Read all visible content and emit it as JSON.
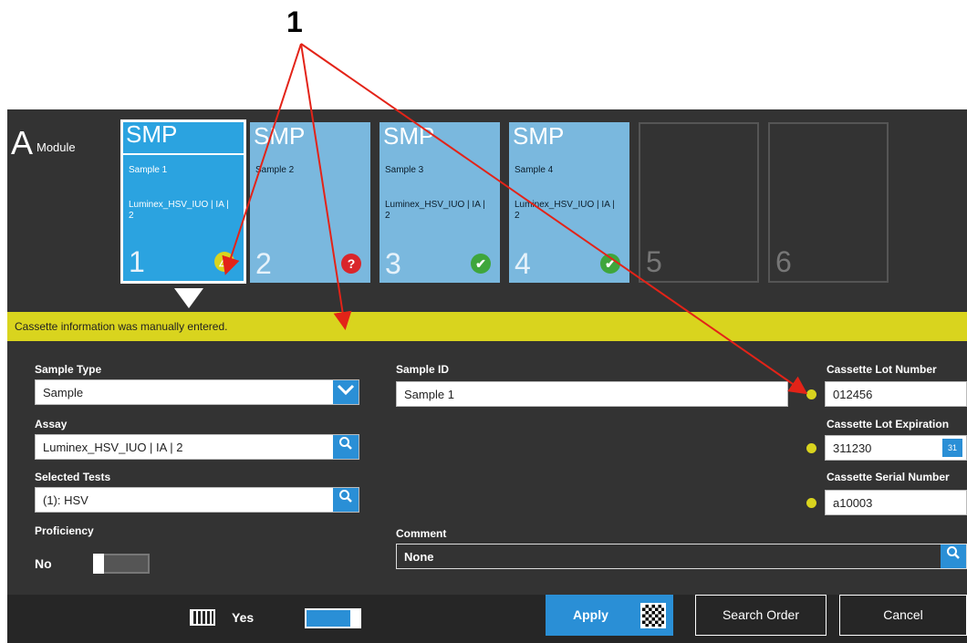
{
  "callout": "1",
  "module": {
    "letter": "A",
    "label": "Module"
  },
  "slots": [
    {
      "header": "SMP",
      "sample": "Sample 1",
      "assay": "Luminex_HSV_IUO | IA | 2",
      "number": "1",
      "status": "warning"
    },
    {
      "header": "SMP",
      "sample": "Sample 2",
      "assay": "",
      "number": "2",
      "status": "error"
    },
    {
      "header": "SMP",
      "sample": "Sample 3",
      "assay": "Luminex_HSV_IUO | IA | 2",
      "number": "3",
      "status": "ok"
    },
    {
      "header": "SMP",
      "sample": "Sample 4",
      "assay": "Luminex_HSV_IUO | IA | 2",
      "number": "4",
      "status": "ok"
    },
    {
      "header": "",
      "sample": "",
      "assay": "",
      "number": "5",
      "status": "empty"
    },
    {
      "header": "",
      "sample": "",
      "assay": "",
      "number": "6",
      "status": "empty"
    }
  ],
  "banner": "Cassette information was manually entered.",
  "form": {
    "sample_type": {
      "label": "Sample Type",
      "value": "Sample"
    },
    "assay": {
      "label": "Assay",
      "value": "Luminex_HSV_IUO | IA | 2"
    },
    "selected_tests": {
      "label": "Selected Tests",
      "value": "(1): HSV"
    },
    "proficiency": {
      "label": "Proficiency",
      "value": "No"
    },
    "sample_id": {
      "label": "Sample ID",
      "value": "Sample 1"
    },
    "comment": {
      "label": "Comment",
      "value": "None"
    },
    "cassette_lot_number": {
      "label": "Cassette Lot Number",
      "value": "012456"
    },
    "cassette_lot_expiration": {
      "label": "Cassette Lot Expiration",
      "value": "311230"
    },
    "cassette_serial_number": {
      "label": "Cassette Serial Number",
      "value": "a10003"
    }
  },
  "bottom": {
    "keyboard_label": "Yes",
    "apply": "Apply",
    "search_order": "Search Order",
    "cancel": "Cancel"
  },
  "icons": {
    "status_warning": "⚠",
    "status_error": "?",
    "status_ok": "✔",
    "dropdown": "⌄",
    "search": "🔍"
  },
  "colors": {
    "accent": "#2a8fd6",
    "banner": "#d9d41e",
    "background": "#333333"
  }
}
